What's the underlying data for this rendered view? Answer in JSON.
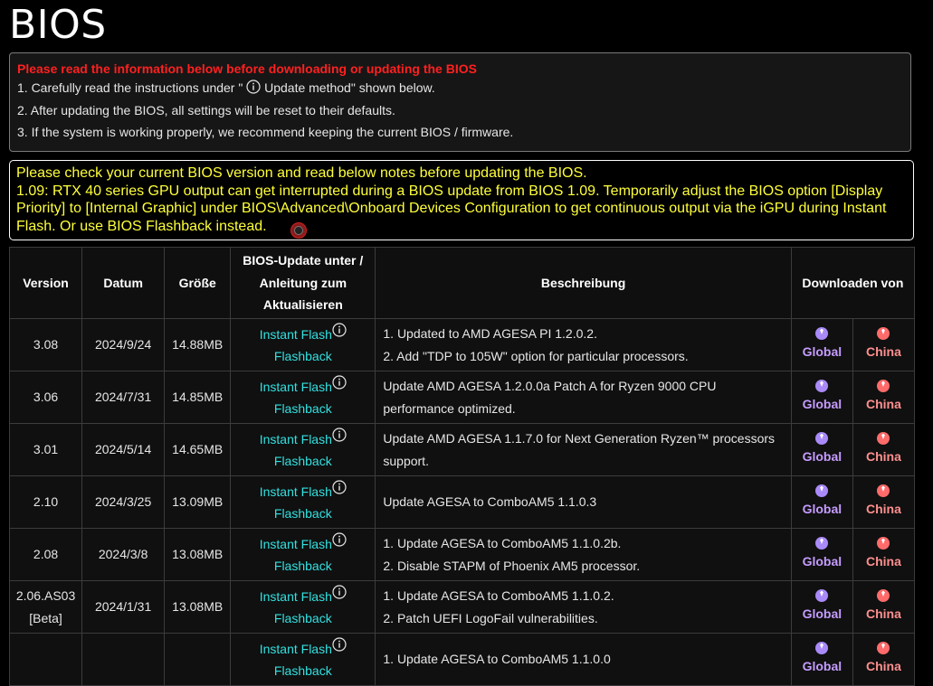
{
  "page_title": "BIOS",
  "notice": {
    "title": "Please read the information below before downloading or updating the BIOS",
    "line1_pre": "1. Carefully read the instructions under \" ",
    "line1_post": " Update method\" shown below.",
    "line2": "2. After updating the BIOS, all settings will be reset to their defaults.",
    "line3": "3. If the system is working properly, we recommend keeping the current BIOS / firmware."
  },
  "warning": {
    "line1": "Please check your current BIOS version and read below notes before updating the BIOS.",
    "line2": "1.09: RTX 40 series GPU output can get interrupted during a BIOS update from BIOS 1.09. Temporarily adjust the BIOS option [Display Priority] to [Internal Graphic] under BIOS\\Advanced\\Onboard Devices Configuration to get continuous output via the iGPU during Instant Flash. Or use BIOS Flashback instead."
  },
  "table": {
    "headers": {
      "version": "Version",
      "date": "Datum",
      "size": "Größe",
      "guide": "BIOS-Update unter / Anleitung zum Aktualisieren",
      "desc": "Beschreibung",
      "download": "Downloaden von"
    },
    "instant_flash": "Instant Flash",
    "flashback": "Flashback",
    "global": "Global",
    "china": "China",
    "rows": [
      {
        "version": "3.08",
        "date": "2024/9/24",
        "size": "14.88MB",
        "desc": [
          "1. Updated to AMD AGESA PI 1.2.0.2.",
          "2. Add \"TDP to 105W\" option for particular processors."
        ]
      },
      {
        "version": "3.06",
        "date": "2024/7/31",
        "size": "14.85MB",
        "desc": [
          "Update AMD AGESA 1.2.0.0a Patch A for Ryzen 9000 CPU",
          "performance optimized."
        ]
      },
      {
        "version": "3.01",
        "date": "2024/5/14",
        "size": "14.65MB",
        "desc": [
          "Update AMD AGESA 1.1.7.0 for Next Generation Ryzen™ processors",
          "support."
        ]
      },
      {
        "version": "2.10",
        "date": "2024/3/25",
        "size": "13.09MB",
        "desc": [
          "Update AGESA to ComboAM5 1.1.0.3"
        ]
      },
      {
        "version": "2.08",
        "date": "2024/3/8",
        "size": "13.08MB",
        "desc": [
          "1. Update AGESA to ComboAM5 1.1.0.2b.",
          "2. Disable STAPM of Phoenix AM5 processor."
        ]
      },
      {
        "version": "2.06.AS03 [Beta]",
        "date": "2024/1/31",
        "size": "13.08MB",
        "desc": [
          "1. Update AGESA to ComboAM5 1.1.0.2.",
          "2. Patch UEFI LogoFail vulnerabilities."
        ]
      },
      {
        "version": "",
        "date": "",
        "size": "",
        "desc": [
          "1. Update AGESA to ComboAM5 1.1.0.0"
        ]
      }
    ]
  },
  "colors": {
    "notice_title": "#ff2020",
    "warning_text": "#ffff3a",
    "link": "#33e0e0",
    "global": "#c59cff",
    "china": "#ff8f8f"
  }
}
